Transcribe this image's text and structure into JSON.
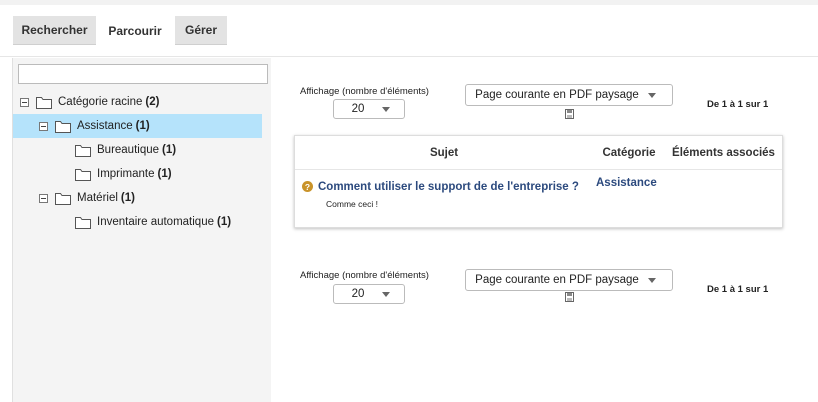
{
  "tabs": [
    {
      "label": "Rechercher"
    },
    {
      "label": "Parcourir"
    },
    {
      "label": "Gérer"
    }
  ],
  "tree": {
    "search_value": "",
    "items": [
      {
        "label": "Catégorie racine",
        "count": "(2)"
      },
      {
        "label": "Assistance",
        "count": "(1)"
      },
      {
        "label": "Bureautique",
        "count": "(1)"
      },
      {
        "label": "Imprimante",
        "count": "(1)"
      },
      {
        "label": "Matériel",
        "count": "(1)"
      },
      {
        "label": "Inventaire automatique",
        "count": "(1)"
      }
    ]
  },
  "controls_top": {
    "display_label": "Affichage (nombre d'éléments)",
    "display_value": "20",
    "export_value": "Page courante en PDF paysage",
    "pager_text": "De 1 à 1 sur 1"
  },
  "controls_bottom": {
    "display_label": "Affichage (nombre d'éléments)",
    "display_value": "20",
    "export_value": "Page courante en PDF paysage",
    "pager_text": "De 1 à 1 sur 1"
  },
  "table": {
    "headers": [
      "Sujet",
      "Catégorie",
      "Éléments associés"
    ],
    "rows": [
      {
        "subject": "Comment utiliser le support de de l'entreprise ?",
        "description": "Comme ceci !",
        "category": "Assistance",
        "associated": ""
      }
    ]
  },
  "icons": {
    "question": "?",
    "question_color": "#c9932a",
    "link_color": "#2c4a7e",
    "selected_bg": "#b5e3fb"
  }
}
